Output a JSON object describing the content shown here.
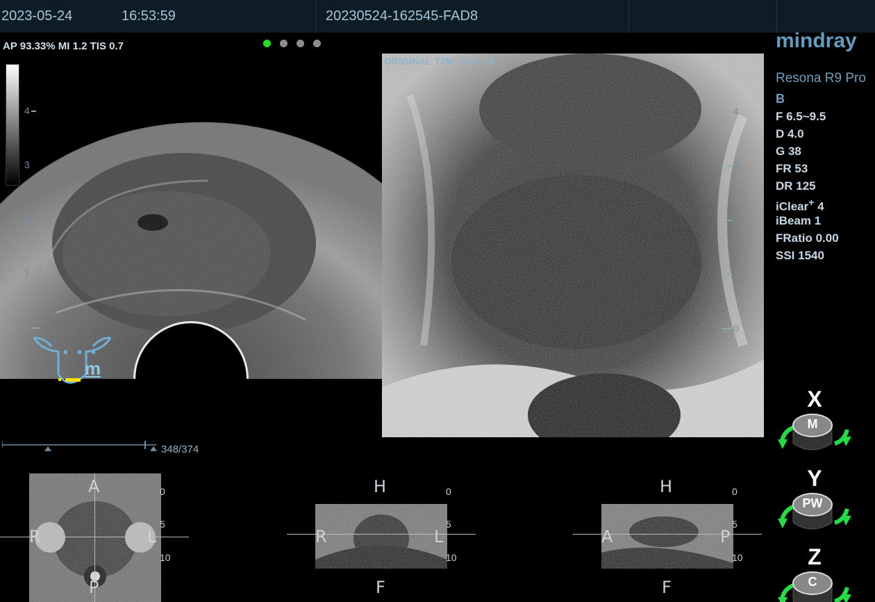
{
  "status_bar": {
    "date": "2023-05-24",
    "time": "16:53:59",
    "exam_id": "20230524-162545-FAD8"
  },
  "acoustic": {
    "text": "AP 93.33%  MI 1.2 TIS 0.7"
  },
  "ultrasound": {
    "depth_scale": [
      "4",
      "3",
      "2",
      "1",
      "0"
    ],
    "probe_marker": "m",
    "colors": {
      "indicator_active": "#22dd22",
      "indicator_idle": "#8c8c8c",
      "marker": "#ffe600",
      "probe_icon": "#6fb0d6"
    }
  },
  "mr": {
    "label": "ORIGINAL    T2W_TSE_ax",
    "depth_scale": [
      "4",
      "3",
      "2",
      "1",
      "0"
    ]
  },
  "brand": {
    "logo": "mindray",
    "model": "Resona R9 Pro"
  },
  "params": [
    {
      "text": "B",
      "mode": true
    },
    {
      "text": "F 6.5~9.5"
    },
    {
      "text": "D 4.0"
    },
    {
      "text": "G 38"
    },
    {
      "text": "FR 53"
    },
    {
      "text": "DR 125"
    },
    {
      "text": "iClear",
      "sup": "+",
      "after": " 4"
    },
    {
      "text": "iBeam 1"
    },
    {
      "text": "FRatio 0.00"
    },
    {
      "text": "SSI 1540"
    }
  ],
  "knobs": [
    {
      "axis": "X",
      "label": "M"
    },
    {
      "axis": "Y",
      "label": "PW"
    },
    {
      "axis": "Z",
      "label": "C"
    }
  ],
  "slider": {
    "counter": "348/374",
    "position_fraction": 0.93
  },
  "mini_views": {
    "axial": {
      "top": "A",
      "bottom": "P",
      "left": "R",
      "right": "L",
      "scale": [
        "0",
        "5",
        "10"
      ]
    },
    "coronal": {
      "top": "H",
      "bottom": "F",
      "left": "R",
      "right": "L",
      "scale": [
        "0",
        "5",
        "10"
      ]
    },
    "sagittal": {
      "top": "H",
      "bottom": "F",
      "left": "A",
      "right": "P",
      "scale": [
        "0",
        "5",
        "10"
      ]
    }
  }
}
